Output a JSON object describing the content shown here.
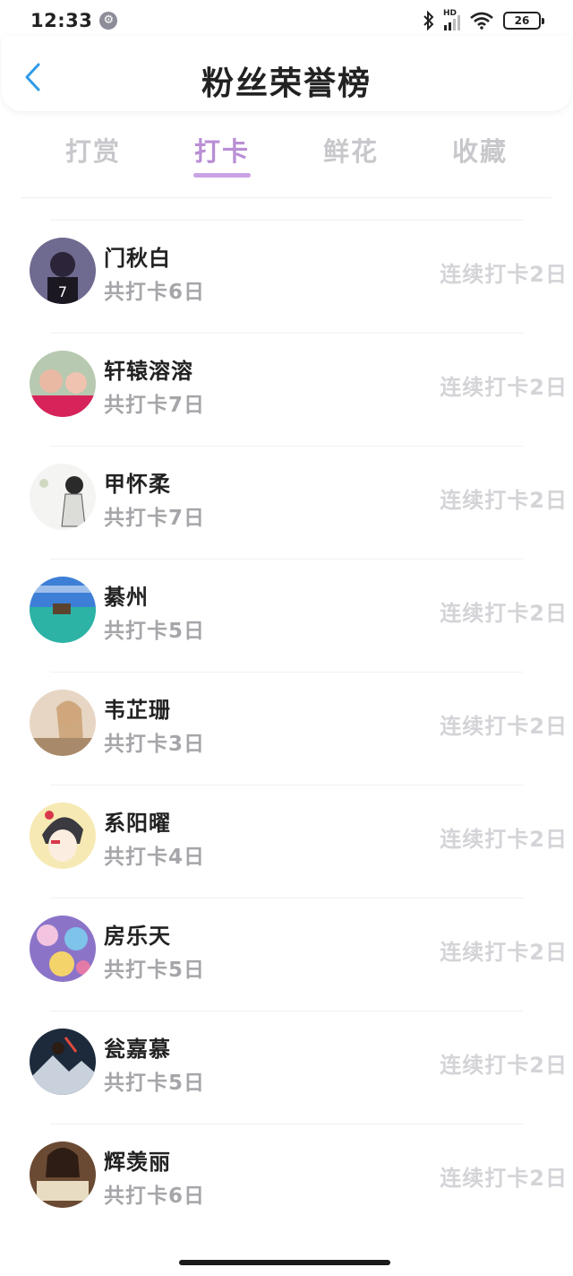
{
  "status_bar": {
    "time": "12:33",
    "network_label": "HD",
    "battery": "26"
  },
  "header": {
    "title": "粉丝荣誉榜"
  },
  "tabs": [
    {
      "label": "打赏",
      "active": false
    },
    {
      "label": "打卡",
      "active": true
    },
    {
      "label": "鲜花",
      "active": false
    },
    {
      "label": "收藏",
      "active": false
    }
  ],
  "colors": {
    "accent": "#c9a2e3",
    "back_arrow": "#2f9ae8"
  },
  "fans": [
    {
      "name": "门秋白",
      "total": "共打卡6日",
      "streak": "连续打卡2日",
      "avatar": "photo"
    },
    {
      "name": "轩辕溶溶",
      "total": "共打卡7日",
      "streak": "连续打卡2日",
      "avatar": "photo"
    },
    {
      "name": "甲怀柔",
      "total": "共打卡7日",
      "streak": "连续打卡2日",
      "avatar": "illustration"
    },
    {
      "name": "綦州",
      "total": "共打卡5日",
      "streak": "连续打卡2日",
      "avatar": "landscape"
    },
    {
      "name": "韦芷珊",
      "total": "共打卡3日",
      "streak": "连续打卡2日",
      "avatar": "photo"
    },
    {
      "name": "系阳曜",
      "total": "共打卡4日",
      "streak": "连续打卡2日",
      "avatar": "illustration"
    },
    {
      "name": "房乐天",
      "total": "共打卡5日",
      "streak": "连续打卡2日",
      "avatar": "illustration"
    },
    {
      "name": "瓮嘉慕",
      "total": "共打卡5日",
      "streak": "连续打卡2日",
      "avatar": "landscape"
    },
    {
      "name": "辉羡丽",
      "total": "共打卡6日",
      "streak": "连续打卡2日",
      "avatar": "photo"
    }
  ]
}
